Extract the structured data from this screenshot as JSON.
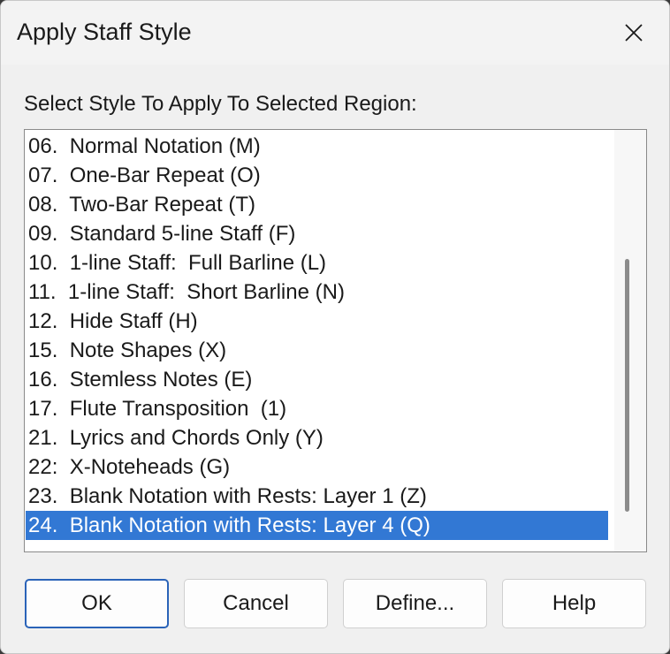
{
  "dialog": {
    "title": "Apply Staff Style",
    "prompt": "Select Style To Apply To Selected Region:"
  },
  "list": {
    "items": [
      "06.  Normal Notation (M)",
      "07.  One-Bar Repeat (O)",
      "08.  Two-Bar Repeat (T)",
      "09.  Standard 5-line Staff (F)",
      "10.  1-line Staff:  Full Barline (L)",
      "11.  1-line Staff:  Short Barline (N)",
      "12.  Hide Staff (H)",
      "15.  Note Shapes (X)",
      "16.  Stemless Notes (E)",
      "17.  Flute Transposition  (1)",
      "21.  Lyrics and Chords Only (Y)",
      "22:  X-Noteheads (G)",
      "23.  Blank Notation with Rests: Layer 1 (Z)",
      "24.  Blank Notation with Rests: Layer 4 (Q)"
    ],
    "selected_index": 13
  },
  "buttons": {
    "ok": "OK",
    "cancel": "Cancel",
    "define": "Define...",
    "help": "Help"
  },
  "colors": {
    "selection": "#3278d4",
    "default_button_border": "#2a63b8"
  },
  "icons": {
    "close": "close-icon"
  }
}
